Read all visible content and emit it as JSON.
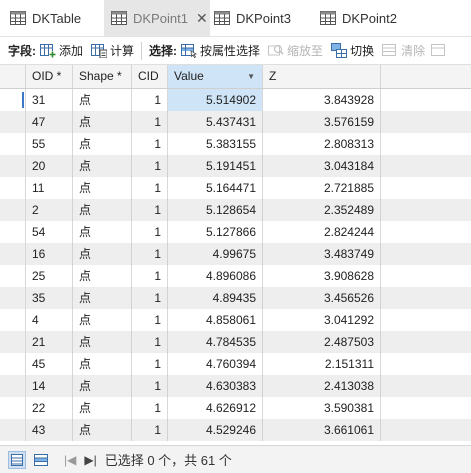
{
  "tabs": [
    {
      "label": "DKTable",
      "active": false,
      "closable": false
    },
    {
      "label": "DKPoint1",
      "active": true,
      "closable": true,
      "close_glyph": "✕"
    },
    {
      "label": "DKPoint3",
      "active": false,
      "closable": false
    },
    {
      "label": "DKPoint2",
      "active": false,
      "closable": false
    }
  ],
  "toolbar": {
    "field_label": "字段:",
    "add_label": "添加",
    "calc_label": "计算",
    "select_label": "选择:",
    "select_by_attr_label": "按属性选择",
    "zoom_to_label": "缩放至",
    "switch_label": "切换",
    "clear_label": "清除"
  },
  "columns": [
    {
      "label": "OID *"
    },
    {
      "label": "Shape *"
    },
    {
      "label": "CID"
    },
    {
      "label": "Value",
      "sorted": true
    },
    {
      "label": "Z"
    }
  ],
  "rows": [
    {
      "oid": "31",
      "shape": "点",
      "cid": "1",
      "value": "5.514902",
      "z": "3.843928"
    },
    {
      "oid": "47",
      "shape": "点",
      "cid": "1",
      "value": "5.437431",
      "z": "3.576159"
    },
    {
      "oid": "55",
      "shape": "点",
      "cid": "1",
      "value": "5.383155",
      "z": "2.808313"
    },
    {
      "oid": "20",
      "shape": "点",
      "cid": "1",
      "value": "5.191451",
      "z": "3.043184"
    },
    {
      "oid": "11",
      "shape": "点",
      "cid": "1",
      "value": "5.164471",
      "z": "2.721885"
    },
    {
      "oid": "2",
      "shape": "点",
      "cid": "1",
      "value": "5.128654",
      "z": "2.352489"
    },
    {
      "oid": "54",
      "shape": "点",
      "cid": "1",
      "value": "5.127866",
      "z": "2.824244"
    },
    {
      "oid": "16",
      "shape": "点",
      "cid": "1",
      "value": "4.99675",
      "z": "3.483749"
    },
    {
      "oid": "25",
      "shape": "点",
      "cid": "1",
      "value": "4.896086",
      "z": "3.908628"
    },
    {
      "oid": "35",
      "shape": "点",
      "cid": "1",
      "value": "4.89435",
      "z": "3.456526"
    },
    {
      "oid": "4",
      "shape": "点",
      "cid": "1",
      "value": "4.858061",
      "z": "3.041292"
    },
    {
      "oid": "21",
      "shape": "点",
      "cid": "1",
      "value": "4.784535",
      "z": "2.487503"
    },
    {
      "oid": "45",
      "shape": "点",
      "cid": "1",
      "value": "4.760394",
      "z": "2.151311"
    },
    {
      "oid": "14",
      "shape": "点",
      "cid": "1",
      "value": "4.630383",
      "z": "2.413038"
    },
    {
      "oid": "22",
      "shape": "点",
      "cid": "1",
      "value": "4.626912",
      "z": "3.590381"
    },
    {
      "oid": "43",
      "shape": "点",
      "cid": "1",
      "value": "4.529246",
      "z": "3.661061"
    }
  ],
  "status": {
    "text": "已选择 0 个，共 61 个"
  },
  "colors": {
    "selected_cell": "#cfe4f6",
    "row_marker": "#3c78c8",
    "alt_row": "#eeeeee"
  }
}
